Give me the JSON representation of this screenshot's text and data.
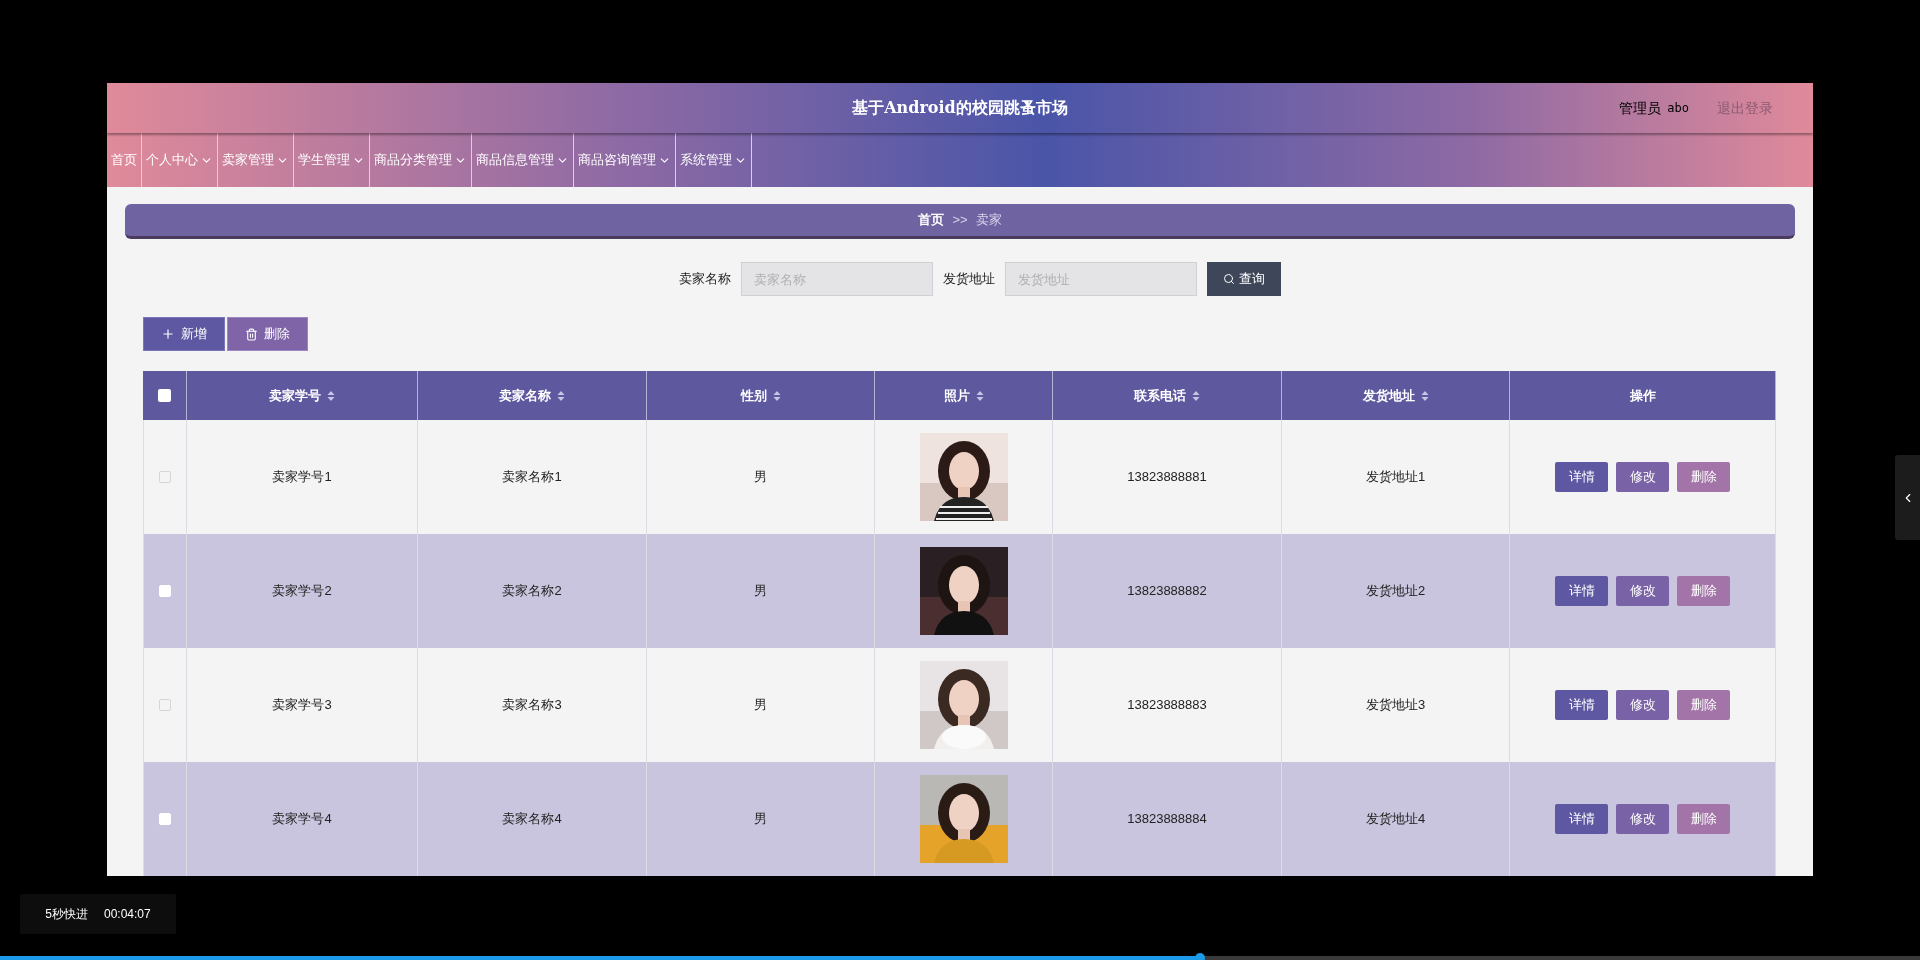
{
  "header": {
    "title": "基于Android的校园跳蚤市场",
    "user_role": "管理员",
    "user_name": "abo",
    "logout": "退出登录"
  },
  "nav": [
    {
      "label": "首页",
      "dropdown": false
    },
    {
      "label": "个人中心",
      "dropdown": true
    },
    {
      "label": "卖家管理",
      "dropdown": true
    },
    {
      "label": "学生管理",
      "dropdown": true
    },
    {
      "label": "商品分类管理",
      "dropdown": true
    },
    {
      "label": "商品信息管理",
      "dropdown": true
    },
    {
      "label": "商品咨询管理",
      "dropdown": true
    },
    {
      "label": "系统管理",
      "dropdown": true
    }
  ],
  "breadcrumb": {
    "home": "首页",
    "separator": ">>",
    "current": "卖家"
  },
  "search": [
    {
      "label": "卖家名称",
      "placeholder": "卖家名称"
    },
    {
      "label": "发货地址",
      "placeholder": "发货地址"
    }
  ],
  "search_button": "查询",
  "toolbar": {
    "add": "新增",
    "delete": "删除"
  },
  "table": {
    "select_all_checked": false,
    "columns": [
      {
        "label": "卖家学号",
        "sortable": true
      },
      {
        "label": "卖家名称",
        "sortable": true
      },
      {
        "label": "性别",
        "sortable": true
      },
      {
        "label": "照片",
        "sortable": true
      },
      {
        "label": "联系电话",
        "sortable": true
      },
      {
        "label": "发货地址",
        "sortable": true
      },
      {
        "label": "操作",
        "sortable": false
      }
    ],
    "rows": [
      {
        "checked": false,
        "id": "卖家学号1",
        "name": "卖家名称1",
        "gender": "男",
        "photo": {
          "kind": "picture"
        },
        "phone": "13823888881",
        "address": "发货地址1",
        "actions": [
          "详情",
          "修改",
          "删除"
        ]
      },
      {
        "checked": false,
        "id": "卖家学号2",
        "name": "卖家名称2",
        "gender": "男",
        "photo": {
          "kind": "picture"
        },
        "phone": "13823888882",
        "address": "发货地址2",
        "actions": [
          "详情",
          "修改",
          "删除"
        ]
      },
      {
        "checked": false,
        "id": "卖家学号3",
        "name": "卖家名称3",
        "gender": "男",
        "photo": {
          "kind": "picture"
        },
        "phone": "13823888883",
        "address": "发货地址3",
        "actions": [
          "详情",
          "修改",
          "删除"
        ]
      },
      {
        "checked": false,
        "id": "卖家学号4",
        "name": "卖家名称4",
        "gender": "男",
        "photo": {
          "kind": "picture"
        },
        "phone": "13823888884",
        "address": "发货地址4",
        "actions": [
          "详情",
          "修改",
          "删除"
        ]
      }
    ]
  },
  "player": {
    "hint": "5秒快进",
    "time": "00:04:07",
    "progress": {
      "level": 0.625
    }
  }
}
